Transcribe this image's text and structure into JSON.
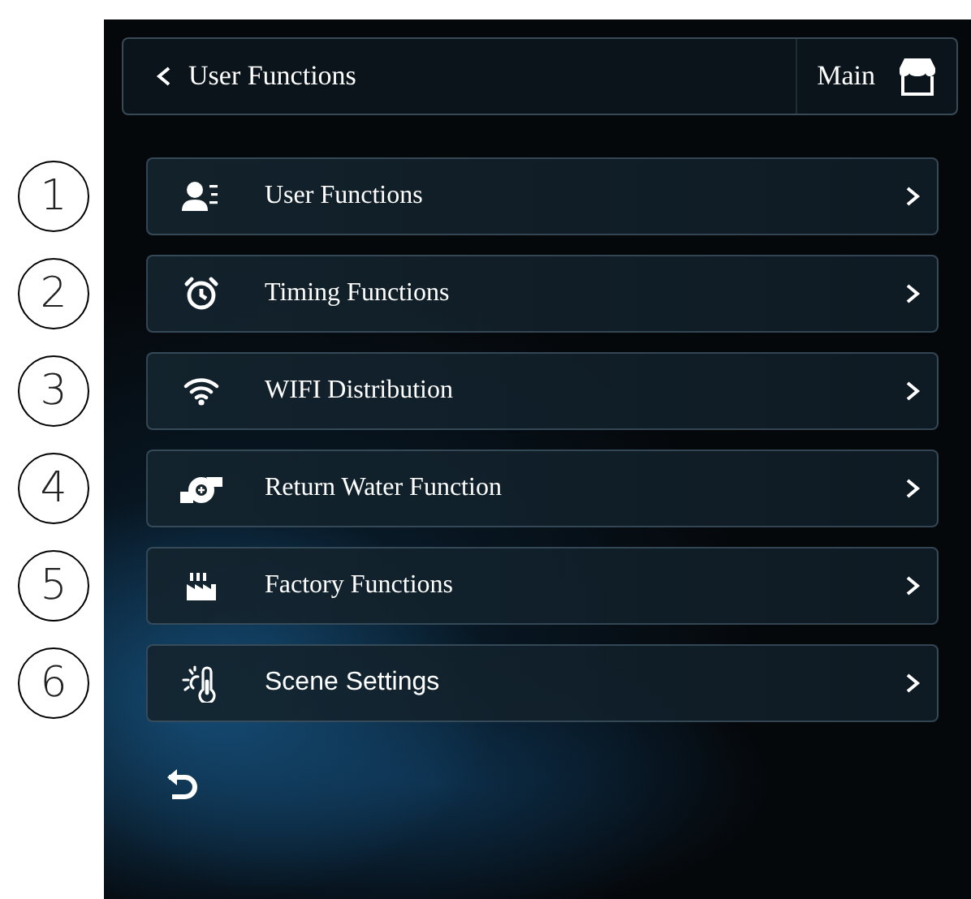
{
  "header": {
    "title": "User Functions",
    "main_label": "Main"
  },
  "menu": [
    {
      "marker": "1",
      "label": "User Functions",
      "kind": "user"
    },
    {
      "marker": "2",
      "label": "Timing Functions",
      "kind": "timer"
    },
    {
      "marker": "3",
      "label": "WIFI Distribution",
      "kind": "wifi"
    },
    {
      "marker": "4",
      "label": "Return Water Function",
      "kind": "pump"
    },
    {
      "marker": "5",
      "label": "Factory Functions",
      "kind": "factory"
    },
    {
      "marker": "6",
      "label": "Scene Settings",
      "kind": "scene"
    }
  ]
}
